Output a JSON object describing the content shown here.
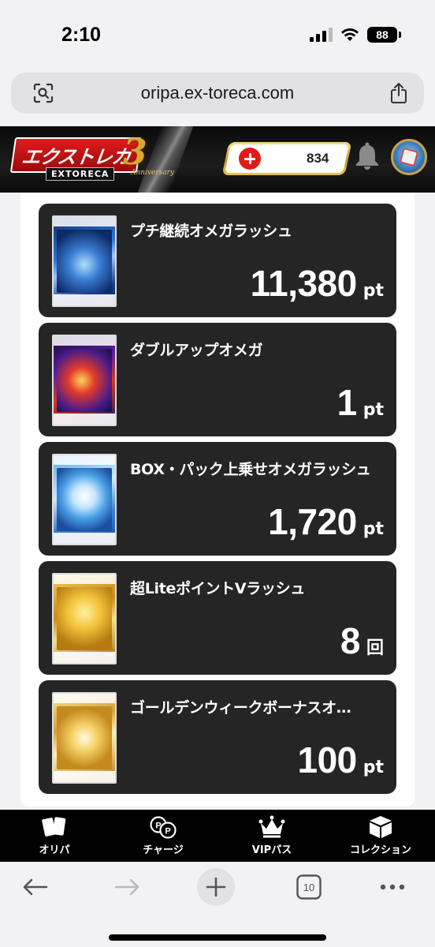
{
  "status_bar": {
    "time": "2:10",
    "battery": "88",
    "icons": [
      "signal-icon",
      "wifi-icon",
      "battery-icon"
    ]
  },
  "browser": {
    "url": "oripa.ex-toreca.com",
    "left_icon": "page-scan-icon",
    "right_icon": "share-icon",
    "tab_count": "10"
  },
  "site_header": {
    "logo_text": "エクストレカ",
    "logo_sub": "EXTORECA",
    "anniversary_number": "3",
    "anniversary_text": "Anniversary",
    "points": "834",
    "colors": {
      "header_bg": "#111111",
      "pill_gold": "#d9a63a",
      "plus_red": "#e21a1a"
    }
  },
  "cards": [
    {
      "title": "プチ継続オメガラッシュ",
      "value": "11,380",
      "unit": "pt",
      "theme": "blue-omega"
    },
    {
      "title": "ダブルアップオメガ",
      "value": "1",
      "unit": "pt",
      "theme": "purple-red-omega"
    },
    {
      "title": "BOX・パック上乗せオメガラッシュ",
      "value": "1,720",
      "unit": "pt",
      "theme": "light-blue-omega"
    },
    {
      "title": "超LiteポイントVラッシュ",
      "value": "8",
      "unit": "回",
      "theme": "gold-coins"
    },
    {
      "title": "ゴールデンウィークボーナスオ…",
      "value": "100",
      "unit": "pt",
      "theme": "gold-ticket"
    }
  ],
  "tab_nav": [
    {
      "label": "オリパ",
      "icon": "cards-icon"
    },
    {
      "label": "チャージ",
      "icon": "coins-icon"
    },
    {
      "label": "VIPパス",
      "icon": "crown-icon"
    },
    {
      "label": "コレクション",
      "icon": "box-icon"
    }
  ],
  "toolbar": {
    "buttons": [
      "back-arrow-icon",
      "forward-arrow-icon",
      "new-tab-plus-icon",
      "tabs-icon",
      "more-icon"
    ]
  }
}
